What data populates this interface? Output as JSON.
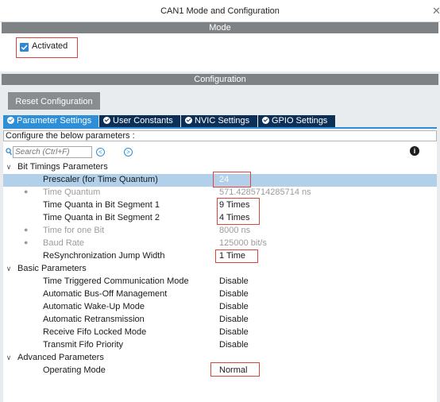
{
  "window": {
    "title": "CAN1 Mode and Configuration"
  },
  "mode_section": {
    "header": "Mode",
    "activated_label": "Activated",
    "activated": true
  },
  "config_section": {
    "header": "Configuration",
    "reset_label": "Reset Configuration",
    "tabs": [
      {
        "label": "Parameter Settings",
        "active": true
      },
      {
        "label": "User Constants",
        "active": false
      },
      {
        "label": "NVIC Settings",
        "active": false
      },
      {
        "label": "GPIO Settings",
        "active": false
      }
    ],
    "hint": "Configure the below parameters :",
    "search": {
      "placeholder": "Search (Ctrl+F)"
    }
  },
  "groups": [
    {
      "label": "Bit Timings Parameters",
      "params": [
        {
          "name": "Prescaler (for Time Quantum)",
          "value": "24",
          "readonly": false
        },
        {
          "name": "Time Quantum",
          "value": "571.4285714285714 ns",
          "readonly": true
        },
        {
          "name": "Time Quanta in Bit Segment 1",
          "value": "9 Times",
          "readonly": false
        },
        {
          "name": "Time Quanta in Bit Segment 2",
          "value": "4 Times",
          "readonly": false
        },
        {
          "name": "Time for one Bit",
          "value": "8000 ns",
          "readonly": true
        },
        {
          "name": "Baud Rate",
          "value": "125000 bit/s",
          "readonly": true
        },
        {
          "name": "ReSynchronization Jump Width",
          "value": "1 Time",
          "readonly": false
        }
      ]
    },
    {
      "label": "Basic Parameters",
      "params": [
        {
          "name": "Time Triggered Communication Mode",
          "value": "Disable"
        },
        {
          "name": "Automatic Bus-Off Management",
          "value": "Disable"
        },
        {
          "name": "Automatic Wake-Up Mode",
          "value": "Disable"
        },
        {
          "name": "Automatic Retransmission",
          "value": "Disable"
        },
        {
          "name": "Receive Fifo Locked Mode",
          "value": "Disable"
        },
        {
          "name": "Transmit Fifo Priority",
          "value": "Disable"
        }
      ]
    },
    {
      "label": "Advanced Parameters",
      "params": [
        {
          "name": "Operating Mode",
          "value": "Normal"
        }
      ]
    }
  ],
  "colors": {
    "accent": "#2e8fd6",
    "tab_dark": "#0c2f57",
    "highlight": "#e0433b",
    "section_bar": "#7f8285",
    "selected_row": "#b2d0ea"
  },
  "icons": {
    "search": "search-icon",
    "prev": "chevron-left-circle-icon",
    "next": "chevron-right-circle-icon",
    "info": "info-icon",
    "close": "close-icon",
    "checkbox": "checkbox-checked-icon"
  }
}
